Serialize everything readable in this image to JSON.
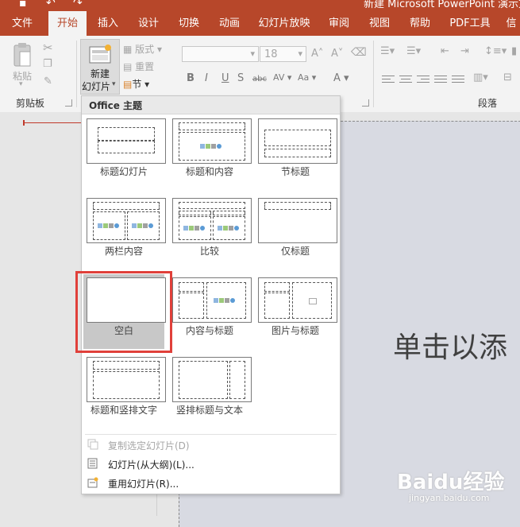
{
  "window": {
    "title": "新建 Microsoft PowerPoint 演示文稿"
  },
  "tabs": [
    {
      "label": "文件"
    },
    {
      "label": "开始"
    },
    {
      "label": "插入"
    },
    {
      "label": "设计"
    },
    {
      "label": "切换"
    },
    {
      "label": "动画"
    },
    {
      "label": "幻灯片放映"
    },
    {
      "label": "审阅"
    },
    {
      "label": "视图"
    },
    {
      "label": "帮助"
    },
    {
      "label": "PDF工具"
    },
    {
      "label": "信"
    }
  ],
  "ribbon": {
    "clipboard": {
      "paste_label": "粘贴",
      "group_label": "剪贴板"
    },
    "slides": {
      "new_slide_label_1": "新建",
      "new_slide_label_2": "幻灯片",
      "layout_label": "版式",
      "reset_label": "重置",
      "section_label": "节"
    },
    "font": {
      "font_name": "",
      "font_size": "18"
    },
    "paragraph": {
      "group_label": "段落"
    }
  },
  "layout_gallery": {
    "header": "Office 主题",
    "layouts": [
      {
        "name": "标题幻灯片"
      },
      {
        "name": "标题和内容"
      },
      {
        "name": "节标题"
      },
      {
        "name": "两栏内容"
      },
      {
        "name": "比较"
      },
      {
        "name": "仅标题"
      },
      {
        "name": "空白",
        "selected": true
      },
      {
        "name": "内容与标题"
      },
      {
        "name": "图片与标题"
      },
      {
        "name": "标题和竖排文字"
      },
      {
        "name": "竖排标题与文本"
      }
    ],
    "menu": [
      {
        "label": "复制选定幻灯片(D)",
        "disabled": true
      },
      {
        "label": "幻灯片(从大纲)(L)..."
      },
      {
        "label": "重用幻灯片(R)..."
      }
    ]
  },
  "slide": {
    "title_placeholder": "单击以添"
  },
  "watermark": {
    "text": "Baidu经验",
    "url": "jingyan.baidu.com"
  },
  "colors": {
    "accent": "#b7472a",
    "highlight_box": "#e0403a"
  }
}
